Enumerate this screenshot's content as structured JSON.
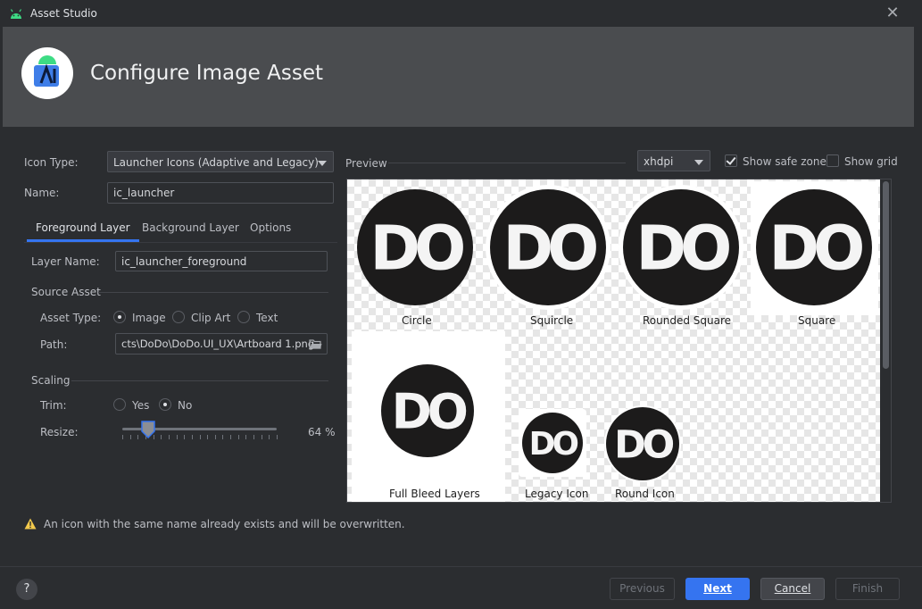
{
  "window": {
    "title": "Asset Studio",
    "close_symbol": "✕"
  },
  "banner": {
    "heading": "Configure Image Asset"
  },
  "form": {
    "icon_type_label": "Icon Type:",
    "icon_type_value": "Launcher Icons (Adaptive and Legacy)",
    "name_label": "Name:",
    "name_value": "ic_launcher"
  },
  "tabs": [
    {
      "label": "Foreground Layer",
      "active": true
    },
    {
      "label": "Background Layer",
      "active": false
    },
    {
      "label": "Options",
      "active": false
    }
  ],
  "foreground": {
    "layer_name_label": "Layer Name:",
    "layer_name_value": "ic_launcher_foreground",
    "source_asset_title": "Source Asset",
    "asset_type_label": "Asset Type:",
    "asset_type_options": [
      "Image",
      "Clip Art",
      "Text"
    ],
    "asset_type_selected": "Image",
    "path_label": "Path:",
    "path_value": "cts\\DoDo\\DoDo.UI_UX\\Artboard 1.png",
    "scaling_title": "Scaling",
    "trim_label": "Trim:",
    "trim_options": [
      "Yes",
      "No"
    ],
    "trim_selected": "No",
    "resize_label": "Resize:",
    "resize_value": 64,
    "resize_text": "64 %"
  },
  "preview": {
    "label": "Preview",
    "density": "xhdpi",
    "show_safe_zone_label": "Show safe zone",
    "show_safe_zone": true,
    "show_grid_label": "Show grid",
    "show_grid": false,
    "icon_text": "DO",
    "icons": [
      {
        "label": "Circle",
        "shape": "circle"
      },
      {
        "label": "Squircle",
        "shape": "squircle"
      },
      {
        "label": "Rounded Square",
        "shape": "rounded-square"
      },
      {
        "label": "Square",
        "shape": "square"
      },
      {
        "label": "Full Bleed Layers",
        "shape": "full-bleed"
      },
      {
        "label": "Legacy Icon",
        "shape": "legacy"
      },
      {
        "label": "Round Icon",
        "shape": "round"
      }
    ]
  },
  "warning": {
    "text": "An icon with the same name already exists and will be overwritten."
  },
  "footer": {
    "help": "?",
    "previous": "Previous",
    "next": "Next",
    "cancel": "Cancel",
    "finish": "Finish"
  },
  "colors": {
    "accent": "#3574f0",
    "warning": "#f2c94c",
    "banner": "#4a4c4f",
    "background": "#2b2d30"
  }
}
